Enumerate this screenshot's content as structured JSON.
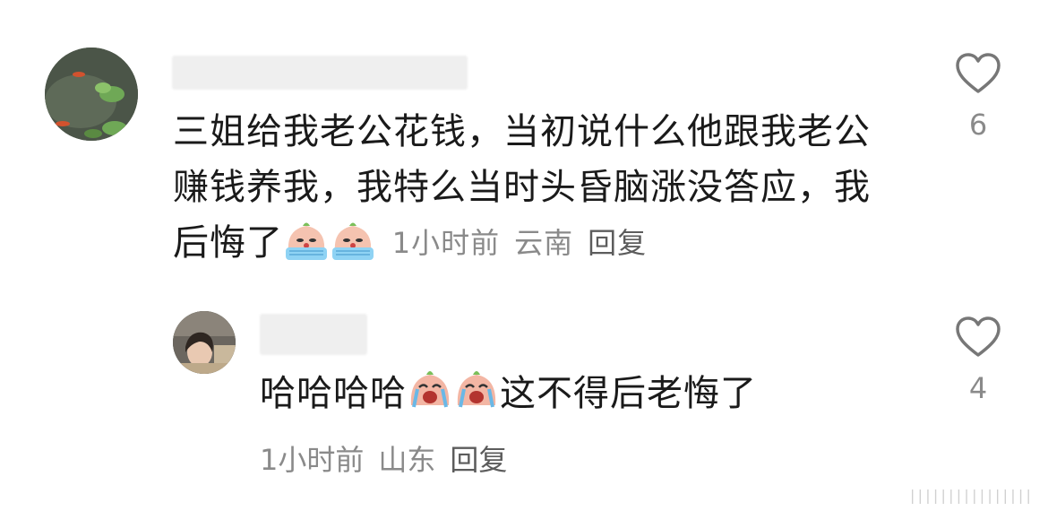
{
  "comments": [
    {
      "text_line1": "三姐给我老公花钱，当初说什么他跟我老公",
      "text_line2": "赚钱养我，我特么当时头昏脑涨没答应，我",
      "text_line3": "后悔了",
      "time": "1小时前",
      "location": "云南",
      "reply_label": "回复",
      "likes": "6",
      "emoji": [
        "cry-emoji",
        "cry-emoji"
      ]
    },
    {
      "text_before": "哈哈哈哈",
      "text_after": "这不得后老悔了",
      "time": "1小时前",
      "location": "山东",
      "reply_label": "回复",
      "likes": "4",
      "emoji": [
        "laugh-cry-emoji",
        "laugh-cry-emoji"
      ]
    }
  ],
  "colors": {
    "text": "#1a1a1a",
    "meta": "#8a8a8a",
    "icon": "#777777"
  },
  "watermark": "||||||||||||||||"
}
